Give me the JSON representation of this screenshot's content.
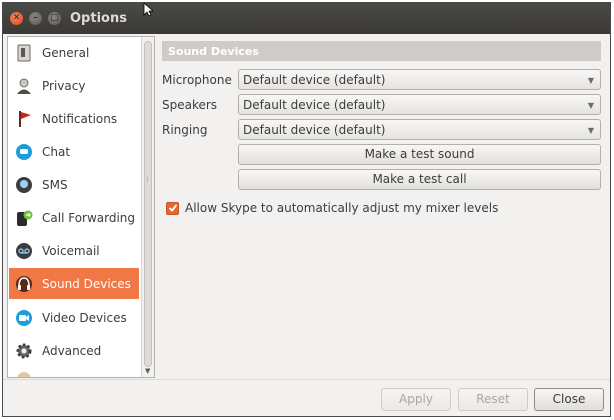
{
  "window": {
    "title": "Options"
  },
  "sidebar": {
    "items": [
      {
        "label": "General",
        "icon": "general-icon"
      },
      {
        "label": "Privacy",
        "icon": "privacy-icon"
      },
      {
        "label": "Notifications",
        "icon": "notifications-icon"
      },
      {
        "label": "Chat",
        "icon": "chat-icon"
      },
      {
        "label": "SMS",
        "icon": "sms-icon"
      },
      {
        "label": "Call Forwarding",
        "icon": "call-forwarding-icon"
      },
      {
        "label": "Voicemail",
        "icon": "voicemail-icon"
      },
      {
        "label": "Sound Devices",
        "icon": "sound-devices-icon",
        "active": true
      },
      {
        "label": "Video Devices",
        "icon": "video-devices-icon"
      },
      {
        "label": "Advanced",
        "icon": "advanced-icon"
      }
    ]
  },
  "content": {
    "section_title": "Sound Devices",
    "microphone": {
      "label": "Microphone",
      "value": "Default device (default)"
    },
    "speakers": {
      "label": "Speakers",
      "value": "Default device (default)"
    },
    "ringing": {
      "label": "Ringing",
      "value": "Default device (default)"
    },
    "test_sound_label": "Make a test sound",
    "test_call_label": "Make a test call",
    "auto_adjust": {
      "label": "Allow Skype to automatically adjust my mixer levels",
      "checked": true
    }
  },
  "footer": {
    "apply": "Apply",
    "reset": "Reset",
    "close": "Close"
  },
  "colors": {
    "accent": "#f07746",
    "titlebar": "#3c3b37"
  }
}
